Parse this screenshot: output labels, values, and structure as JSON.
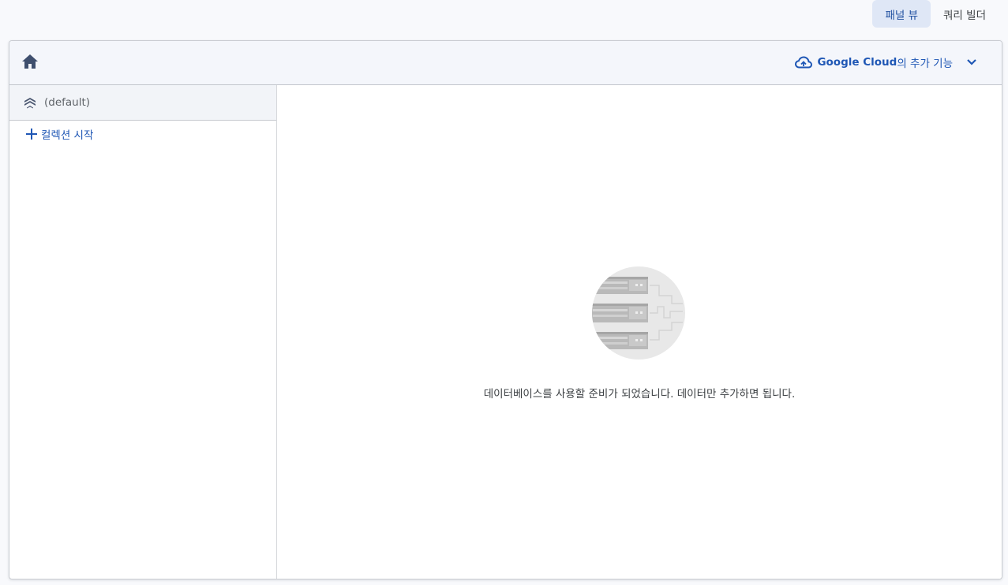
{
  "view_toggle": {
    "panel_view": "패널 뷰",
    "query_builder": "쿼리 빌더",
    "active": "panel_view"
  },
  "header": {
    "home_icon": "home-icon",
    "extensions": {
      "brand": "Google Cloud",
      "suffix": "의 추가 기능",
      "icon": "cloud-icon"
    }
  },
  "sidebar": {
    "database": {
      "label": "(default)",
      "icon": "database-stack-icon"
    },
    "start_collection": "컬렉션 시작"
  },
  "main": {
    "empty_message": "데이터베이스를 사용할 준비가 되었습니다. 데이터만 추가하면 됩니다.",
    "illustration": "server-rack-illustration"
  },
  "colors": {
    "accent": "#1f57b5",
    "active_toggle_bg": "#dfe7f6",
    "page_bg": "#f8f9fc",
    "header_bg": "#f4f6fb"
  }
}
